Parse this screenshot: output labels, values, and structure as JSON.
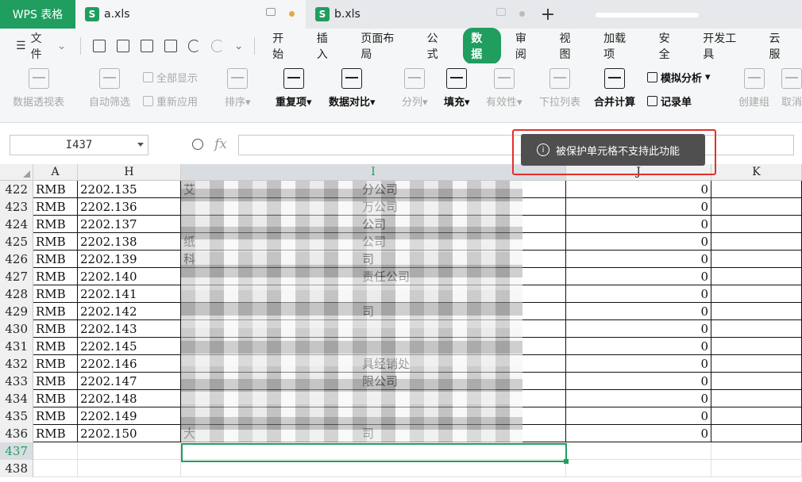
{
  "tabs": {
    "app": "WPS 表格",
    "docs": [
      {
        "icon": "S",
        "name": "a.xls"
      },
      {
        "icon": "S",
        "name": "b.xls"
      }
    ],
    "new_tab": "+"
  },
  "menu": {
    "file": "文件",
    "items": [
      "开始",
      "插入",
      "页面布局",
      "公式",
      "数据",
      "审阅",
      "视图",
      "加载项",
      "安全",
      "开发工具",
      "云服"
    ],
    "active": "数据"
  },
  "ribbon": {
    "pivot": "数据透视表",
    "autofilter": "自动筛选",
    "show_all": "全部显示",
    "reapply": "重新应用",
    "sort": "排序",
    "duplicates": "重复项",
    "compare": "数据对比",
    "split": "分列",
    "fill": "填充",
    "validity": "有效性",
    "dropdown": "下拉列表",
    "consolidate": "合并计算",
    "whatif": "模拟分析",
    "record": "记录单",
    "group": "创建组",
    "ungroup": "取消"
  },
  "formula_bar": {
    "name_box": "I437",
    "fx": "fx",
    "content": ""
  },
  "toast": {
    "icon": "info-icon",
    "message": "被保护单元格不支持此功能"
  },
  "columns": [
    "A",
    "H",
    "I",
    "J",
    "K"
  ],
  "rows": [
    {
      "n": "422",
      "a": "RMB",
      "h": "2202.135",
      "i": "艾",
      "i2": "分公司",
      "j": "0"
    },
    {
      "n": "423",
      "a": "RMB",
      "h": "2202.136",
      "i": "",
      "i2": "万公司",
      "j": "0"
    },
    {
      "n": "424",
      "a": "RMB",
      "h": "2202.137",
      "i": "",
      "i2": "公司",
      "j": "0"
    },
    {
      "n": "425",
      "a": "RMB",
      "h": "2202.138",
      "i": "纸",
      "i2": "公司",
      "j": "0"
    },
    {
      "n": "426",
      "a": "RMB",
      "h": "2202.139",
      "i": "科",
      "i2": "司",
      "j": "0"
    },
    {
      "n": "427",
      "a": "RMB",
      "h": "2202.140",
      "i": "",
      "i2": "责任公司",
      "j": "0"
    },
    {
      "n": "428",
      "a": "RMB",
      "h": "2202.141",
      "i": "",
      "i2": "",
      "j": "0"
    },
    {
      "n": "429",
      "a": "RMB",
      "h": "2202.142",
      "i": "",
      "i2": "司",
      "j": "0"
    },
    {
      "n": "430",
      "a": "RMB",
      "h": "2202.143",
      "i": "",
      "i2": "",
      "j": "0"
    },
    {
      "n": "431",
      "a": "RMB",
      "h": "2202.145",
      "i": "",
      "i2": "",
      "j": "0"
    },
    {
      "n": "432",
      "a": "RMB",
      "h": "2202.146",
      "i": "",
      "i2": "具经销处",
      "j": "0"
    },
    {
      "n": "433",
      "a": "RMB",
      "h": "2202.147",
      "i": "",
      "i2": "限公司",
      "j": "0"
    },
    {
      "n": "434",
      "a": "RMB",
      "h": "2202.148",
      "i": "",
      "i2": "",
      "j": "0"
    },
    {
      "n": "435",
      "a": "RMB",
      "h": "2202.149",
      "i": "",
      "i2": "",
      "j": "0"
    },
    {
      "n": "436",
      "a": "RMB",
      "h": "2202.150",
      "i": "大",
      "i2": "司",
      "j": "0"
    },
    {
      "n": "437",
      "a": "",
      "h": "",
      "i": "",
      "i2": "",
      "j": ""
    },
    {
      "n": "438",
      "a": "",
      "h": "",
      "i": "",
      "i2": "",
      "j": ""
    }
  ],
  "colors": {
    "accent": "#1f9e5f",
    "highlight": "#e4302a"
  }
}
